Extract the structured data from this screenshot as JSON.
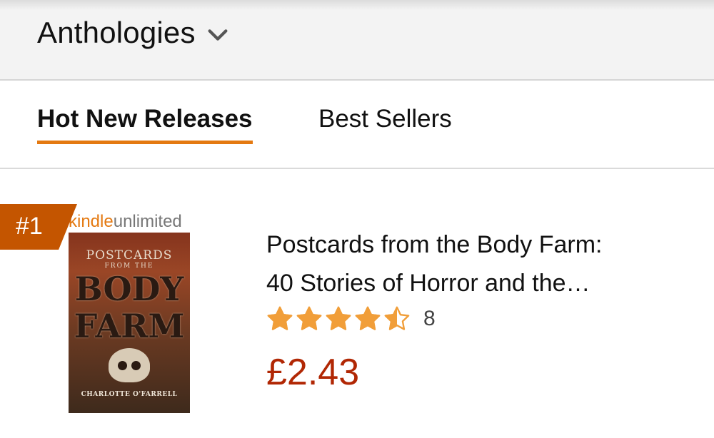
{
  "header": {
    "category_label": "Anthologies",
    "chevron_icon": "chevron-down-icon"
  },
  "tabs": [
    {
      "label": "Hot New Releases",
      "active": true
    },
    {
      "label": "Best Sellers",
      "active": false
    }
  ],
  "item": {
    "rank": "#1",
    "cover": {
      "badge_kindle": "kindle",
      "badge_unlimited": "unlimited",
      "title_line1": "POSTCARDS",
      "title_line2": "FROM THE",
      "title_line3": "BODY",
      "title_line4": "FARM",
      "author": "CHARLOTTE O'FARRELL"
    },
    "title_line1": "Postcards from the Body Farm:",
    "title_line2": "40 Stories of Horror and the…",
    "rating_stars": 4.5,
    "review_count": "8",
    "price": "£2.43"
  },
  "colors": {
    "accent": "#e47911",
    "badge": "#c45500",
    "price": "#b12704",
    "star": "#f19e39"
  }
}
